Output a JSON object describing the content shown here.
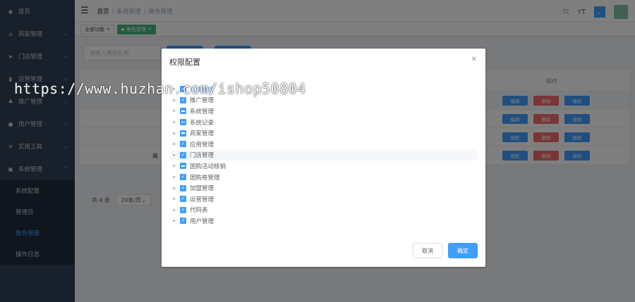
{
  "sidebar": {
    "items": [
      {
        "label": "首页",
        "icon": "dashboard-icon",
        "has_children": false
      },
      {
        "label": "商家管理",
        "icon": "shop-icon",
        "has_children": true
      },
      {
        "label": "门店管理",
        "icon": "send-icon",
        "has_children": true
      },
      {
        "label": "运营管理",
        "icon": "chart-icon",
        "has_children": true
      },
      {
        "label": "推广管理",
        "icon": "tree-icon",
        "has_children": true
      },
      {
        "label": "用户管理",
        "icon": "user-icon",
        "has_children": true
      },
      {
        "label": "实用工具",
        "icon": "tool-icon",
        "has_children": true
      },
      {
        "label": "系统管理",
        "icon": "system-icon",
        "has_children": true
      }
    ],
    "sub_items": [
      {
        "label": "系统配置",
        "active": false
      },
      {
        "label": "管理员",
        "active": false
      },
      {
        "label": "角色管理",
        "active": true
      },
      {
        "label": "操作日志",
        "active": false
      }
    ]
  },
  "header": {
    "breadcrumb": [
      "首页",
      "系统管理",
      "角色管理"
    ],
    "tools": {
      "fullscreen_icon": "fullscreen-icon",
      "font_size_icon": "font-size-icon",
      "font_size_glyph": "тT"
    }
  },
  "tags": [
    {
      "label": "全部功能",
      "active": false
    },
    {
      "label": "角色管理",
      "active": true
    }
  ],
  "content": {
    "search_placeholder": "请输入角色名称",
    "op_header": "操作",
    "partial_cell": "高",
    "row_buttons": {
      "edit": "编辑",
      "delete": "删除",
      "auth": "授权"
    },
    "pager_total": "共 4 条",
    "pager_size": "20条/页"
  },
  "dialog": {
    "title": "权限配置",
    "tree": [
      {
        "label": "系统管理",
        "state": "checked",
        "first": true
      },
      {
        "label": "推广管理",
        "state": "checked"
      },
      {
        "label": "系统管理",
        "state": "half"
      },
      {
        "label": "系统记录",
        "state": "half"
      },
      {
        "label": "商家管理",
        "state": "half"
      },
      {
        "label": "应用管理",
        "state": "checked"
      },
      {
        "label": "门店管理",
        "state": "checked",
        "highlight": true
      },
      {
        "label": "团购活动核销",
        "state": "half"
      },
      {
        "label": "团购卷管理",
        "state": "checked"
      },
      {
        "label": "加盟管理",
        "state": "checked"
      },
      {
        "label": "运营管理",
        "state": "checked"
      },
      {
        "label": "代码表",
        "state": "checked"
      },
      {
        "label": "用户管理",
        "state": "checked"
      }
    ],
    "cancel_label": "取消",
    "ok_label": "确定"
  },
  "watermark": "https://www.huzhan.com/ishop50804",
  "colors": {
    "primary": "#409eff",
    "danger": "#f56c6c",
    "success": "#42b983",
    "sidebar": "#304156"
  }
}
